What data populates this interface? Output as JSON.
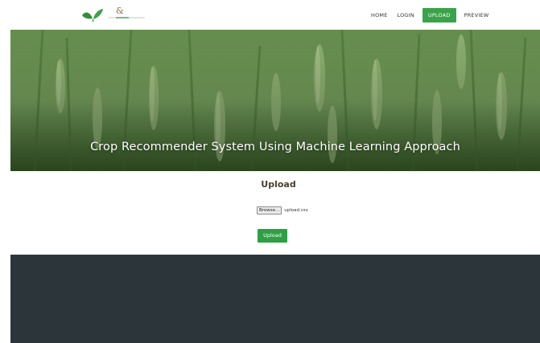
{
  "header": {
    "logo_icon": "leaf-sprout-icon",
    "nav": [
      {
        "label": "HOME",
        "active": false
      },
      {
        "label": "LOGIN",
        "active": false
      },
      {
        "label": "UPLOAD",
        "active": true
      },
      {
        "label": "PREVIEW",
        "active": false
      }
    ]
  },
  "hero": {
    "title": "Crop Recommender System Using Machine Learning Approach"
  },
  "upload": {
    "heading": "Upload",
    "browse_label": "Browse...",
    "file_name": "upload.csv",
    "submit_label": "Upload"
  },
  "colors": {
    "accent": "#3aa34a",
    "button": "#2ea043",
    "footer": "#2c353a",
    "heading": "#4a3f2c"
  }
}
